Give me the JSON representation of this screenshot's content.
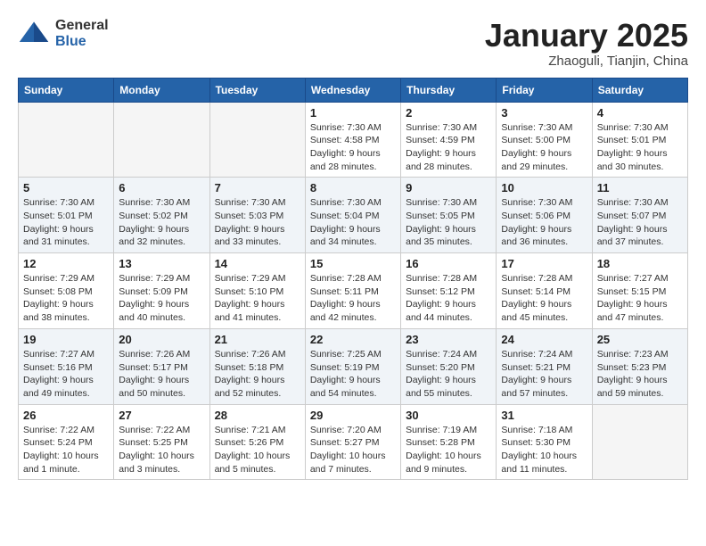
{
  "header": {
    "logo_general": "General",
    "logo_blue": "Blue",
    "month_title": "January 2025",
    "subtitle": "Zhaoguli, Tianjin, China"
  },
  "days_of_week": [
    "Sunday",
    "Monday",
    "Tuesday",
    "Wednesday",
    "Thursday",
    "Friday",
    "Saturday"
  ],
  "weeks": [
    {
      "shaded": false,
      "days": [
        {
          "num": "",
          "info": ""
        },
        {
          "num": "",
          "info": ""
        },
        {
          "num": "",
          "info": ""
        },
        {
          "num": "1",
          "info": "Sunrise: 7:30 AM\nSunset: 4:58 PM\nDaylight: 9 hours\nand 28 minutes."
        },
        {
          "num": "2",
          "info": "Sunrise: 7:30 AM\nSunset: 4:59 PM\nDaylight: 9 hours\nand 28 minutes."
        },
        {
          "num": "3",
          "info": "Sunrise: 7:30 AM\nSunset: 5:00 PM\nDaylight: 9 hours\nand 29 minutes."
        },
        {
          "num": "4",
          "info": "Sunrise: 7:30 AM\nSunset: 5:01 PM\nDaylight: 9 hours\nand 30 minutes."
        }
      ]
    },
    {
      "shaded": true,
      "days": [
        {
          "num": "5",
          "info": "Sunrise: 7:30 AM\nSunset: 5:01 PM\nDaylight: 9 hours\nand 31 minutes."
        },
        {
          "num": "6",
          "info": "Sunrise: 7:30 AM\nSunset: 5:02 PM\nDaylight: 9 hours\nand 32 minutes."
        },
        {
          "num": "7",
          "info": "Sunrise: 7:30 AM\nSunset: 5:03 PM\nDaylight: 9 hours\nand 33 minutes."
        },
        {
          "num": "8",
          "info": "Sunrise: 7:30 AM\nSunset: 5:04 PM\nDaylight: 9 hours\nand 34 minutes."
        },
        {
          "num": "9",
          "info": "Sunrise: 7:30 AM\nSunset: 5:05 PM\nDaylight: 9 hours\nand 35 minutes."
        },
        {
          "num": "10",
          "info": "Sunrise: 7:30 AM\nSunset: 5:06 PM\nDaylight: 9 hours\nand 36 minutes."
        },
        {
          "num": "11",
          "info": "Sunrise: 7:30 AM\nSunset: 5:07 PM\nDaylight: 9 hours\nand 37 minutes."
        }
      ]
    },
    {
      "shaded": false,
      "days": [
        {
          "num": "12",
          "info": "Sunrise: 7:29 AM\nSunset: 5:08 PM\nDaylight: 9 hours\nand 38 minutes."
        },
        {
          "num": "13",
          "info": "Sunrise: 7:29 AM\nSunset: 5:09 PM\nDaylight: 9 hours\nand 40 minutes."
        },
        {
          "num": "14",
          "info": "Sunrise: 7:29 AM\nSunset: 5:10 PM\nDaylight: 9 hours\nand 41 minutes."
        },
        {
          "num": "15",
          "info": "Sunrise: 7:28 AM\nSunset: 5:11 PM\nDaylight: 9 hours\nand 42 minutes."
        },
        {
          "num": "16",
          "info": "Sunrise: 7:28 AM\nSunset: 5:12 PM\nDaylight: 9 hours\nand 44 minutes."
        },
        {
          "num": "17",
          "info": "Sunrise: 7:28 AM\nSunset: 5:14 PM\nDaylight: 9 hours\nand 45 minutes."
        },
        {
          "num": "18",
          "info": "Sunrise: 7:27 AM\nSunset: 5:15 PM\nDaylight: 9 hours\nand 47 minutes."
        }
      ]
    },
    {
      "shaded": true,
      "days": [
        {
          "num": "19",
          "info": "Sunrise: 7:27 AM\nSunset: 5:16 PM\nDaylight: 9 hours\nand 49 minutes."
        },
        {
          "num": "20",
          "info": "Sunrise: 7:26 AM\nSunset: 5:17 PM\nDaylight: 9 hours\nand 50 minutes."
        },
        {
          "num": "21",
          "info": "Sunrise: 7:26 AM\nSunset: 5:18 PM\nDaylight: 9 hours\nand 52 minutes."
        },
        {
          "num": "22",
          "info": "Sunrise: 7:25 AM\nSunset: 5:19 PM\nDaylight: 9 hours\nand 54 minutes."
        },
        {
          "num": "23",
          "info": "Sunrise: 7:24 AM\nSunset: 5:20 PM\nDaylight: 9 hours\nand 55 minutes."
        },
        {
          "num": "24",
          "info": "Sunrise: 7:24 AM\nSunset: 5:21 PM\nDaylight: 9 hours\nand 57 minutes."
        },
        {
          "num": "25",
          "info": "Sunrise: 7:23 AM\nSunset: 5:23 PM\nDaylight: 9 hours\nand 59 minutes."
        }
      ]
    },
    {
      "shaded": false,
      "days": [
        {
          "num": "26",
          "info": "Sunrise: 7:22 AM\nSunset: 5:24 PM\nDaylight: 10 hours\nand 1 minute."
        },
        {
          "num": "27",
          "info": "Sunrise: 7:22 AM\nSunset: 5:25 PM\nDaylight: 10 hours\nand 3 minutes."
        },
        {
          "num": "28",
          "info": "Sunrise: 7:21 AM\nSunset: 5:26 PM\nDaylight: 10 hours\nand 5 minutes."
        },
        {
          "num": "29",
          "info": "Sunrise: 7:20 AM\nSunset: 5:27 PM\nDaylight: 10 hours\nand 7 minutes."
        },
        {
          "num": "30",
          "info": "Sunrise: 7:19 AM\nSunset: 5:28 PM\nDaylight: 10 hours\nand 9 minutes."
        },
        {
          "num": "31",
          "info": "Sunrise: 7:18 AM\nSunset: 5:30 PM\nDaylight: 10 hours\nand 11 minutes."
        },
        {
          "num": "",
          "info": ""
        }
      ]
    }
  ]
}
